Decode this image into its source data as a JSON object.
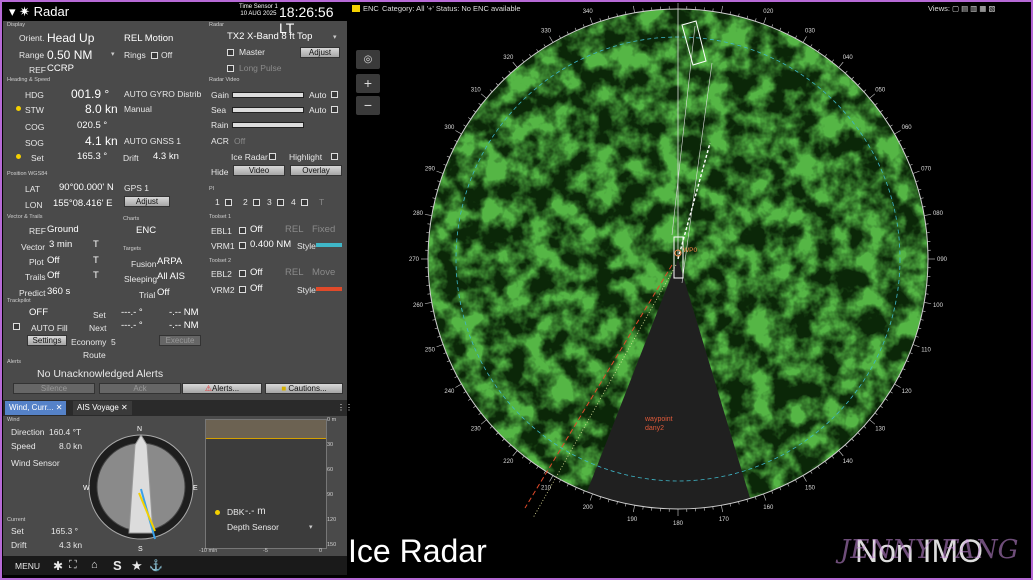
{
  "header": {
    "title": "Radar",
    "time_sensor": "Time Sensor 1",
    "date": "10 AUG 2025",
    "clock": "18:26:56 LT"
  },
  "display": {
    "section": "Display",
    "orient_label": "Orient.",
    "orient_value": "Head Up",
    "motion_value": "REL Motion",
    "range_label": "Range",
    "range_value": "0.50 NM",
    "rings_label": "Rings",
    "rings_value": "Off",
    "ref_label": "REF",
    "ref_value": "CCRP"
  },
  "radar": {
    "section": "Radar",
    "source": "TX2 X-Band 8 ft Top",
    "master_label": "Master",
    "adjust_label": "Adjust",
    "long_pulse_label": "Long Pulse"
  },
  "heading_speed": {
    "section": "Heading & Speed",
    "hdg_label": "HDG",
    "hdg_value": "001.9 °",
    "hdg_source": "AUTO GYRO Distrib",
    "stw_label": "STW",
    "stw_value": "8.0 kn",
    "stw_source": "Manual",
    "cog_label": "COG",
    "cog_value": "020.5 °",
    "sog_label": "SOG",
    "sog_value": "4.1 kn",
    "sog_source": "AUTO GNSS 1",
    "set_label": "Set",
    "set_value": "165.3 °",
    "drift_label": "Drift",
    "drift_value": "4.3 kn"
  },
  "radar_video": {
    "section": "Radar Video",
    "gain_label": "Gain",
    "sea_label": "Sea",
    "rain_label": "Rain",
    "auto_label": "Auto",
    "acr_label": "ACR",
    "acr_value": "Off",
    "ice_radar_label": "Ice Radar",
    "highlight_label": "Highlight",
    "hide_label": "Hide",
    "video_btn": "Video",
    "overlay_btn": "Overlay"
  },
  "position": {
    "section": "Position WGS84",
    "lat_label": "LAT",
    "lat_value": "90°00.000' N",
    "lat_source": "GPS 1",
    "lon_label": "LON",
    "lon_value": "155°08.416' E",
    "adjust_label": "Adjust"
  },
  "pi": {
    "section": "PI",
    "items": [
      "1",
      "2",
      "3",
      "4"
    ],
    "t_label": "T"
  },
  "vector_trails": {
    "section": "Vector & Trails",
    "ref_label": "REF",
    "ref_value": "Ground",
    "vector_label": "Vector",
    "vector_value": "3 min",
    "vector_mode": "T",
    "plot_label": "Plot",
    "plot_value": "Off",
    "plot_mode": "T",
    "trails_label": "Trails",
    "trails_value": "Off",
    "trails_mode": "T",
    "predict_label": "Predict",
    "predict_value": "360 s"
  },
  "charts": {
    "section": "Charts",
    "value": "ENC"
  },
  "targets": {
    "section": "Targets",
    "fusion_label": "Fusion",
    "fusion_value": "ARPA",
    "sleeping_label": "Sleeping",
    "sleeping_value": "All AIS",
    "trial_label": "Trial",
    "trial_value": "Off"
  },
  "toolset1": {
    "section": "Toolset 1",
    "ebl1_label": "EBL1",
    "ebl1_value": "Off",
    "ebl1_ref": "REL",
    "ebl1_mode": "Fixed",
    "vrm1_label": "VRM1",
    "vrm1_value": "0.400 NM",
    "style_label": "Style"
  },
  "toolset2": {
    "section": "Toolset 2",
    "ebl2_label": "EBL2",
    "ebl2_value": "Off",
    "ebl2_ref": "REL",
    "ebl2_mode": "Move",
    "vrm2_label": "VRM2",
    "vrm2_value": "Off",
    "style_label": "Style"
  },
  "trackpilot": {
    "section": "Trackpilot",
    "state": "OFF",
    "autofill_label": "AUTO Fill",
    "settings_btn": "Settings",
    "set_label": "Set",
    "set_value": "---.- °",
    "set_nm": "-.-- NM",
    "next_label": "Next",
    "next_value": "---.- °",
    "next_nm": "-.-- NM",
    "economy_label": "Economy",
    "economy_value": "5",
    "execute_btn": "Execute",
    "route_label": "Route"
  },
  "alerts": {
    "section": "Alerts",
    "message": "No Unacknowledged Alerts",
    "silence_btn": "Silence",
    "ack_btn": "Ack",
    "alerts_btn": "Alerts...",
    "cautions_btn": "Cautions..."
  },
  "tabs": [
    {
      "label": "Wind, Curr..."
    },
    {
      "label": "AIS Voyage"
    }
  ],
  "wind": {
    "section": "Wind",
    "direction_label": "Direction",
    "direction_value": "160.4 °T",
    "speed_label": "Speed",
    "speed_value": "8.0 kn",
    "sensor_value": "Wind Sensor",
    "current_section": "Current",
    "set_label": "Set",
    "set_value": "165.3 °",
    "drift_label": "Drift",
    "drift_value": "4.3 kn",
    "compass": {
      "n": "N",
      "s": "S",
      "e": "E",
      "w": "W"
    }
  },
  "depth": {
    "y_ticks": [
      "0 m",
      "30",
      "60",
      "90",
      "120",
      "150"
    ],
    "x_ticks": [
      "-10 min",
      "-5",
      "0"
    ],
    "dbk_label": "DBK",
    "dbk_value": "-.- m",
    "sensor_value": "Depth Sensor"
  },
  "bottom_bar": {
    "menu_label": "MENU",
    "s_label": "S"
  },
  "enc_bar": {
    "label": "ENC",
    "category": "Category: All '+' Status: No ENC available",
    "views": "Views:"
  },
  "overlay": {
    "ice_radar_text": "Ice Radar",
    "non_imo_text": "Non IMO",
    "watermark": "JENNY FANG",
    "waypoint_name": "waypoint",
    "waypoint_id": "dany2",
    "target_label": "WP0"
  },
  "bearings": [
    "000",
    "010",
    "020",
    "030",
    "040",
    "050",
    "060",
    "070",
    "080",
    "090",
    "100",
    "110",
    "120",
    "130",
    "140",
    "150",
    "160",
    "170",
    "180",
    "190",
    "200",
    "210",
    "220",
    "230",
    "240",
    "250",
    "260",
    "270",
    "280",
    "290",
    "300",
    "310",
    "320",
    "330",
    "340",
    "350"
  ],
  "colors": {
    "echo": "#3aa01c",
    "panel": "#4a4a4a",
    "accent": "#f4d000",
    "frame": "#b76ad6",
    "ring": "#3fb7c8",
    "route": "#e04a2a"
  }
}
